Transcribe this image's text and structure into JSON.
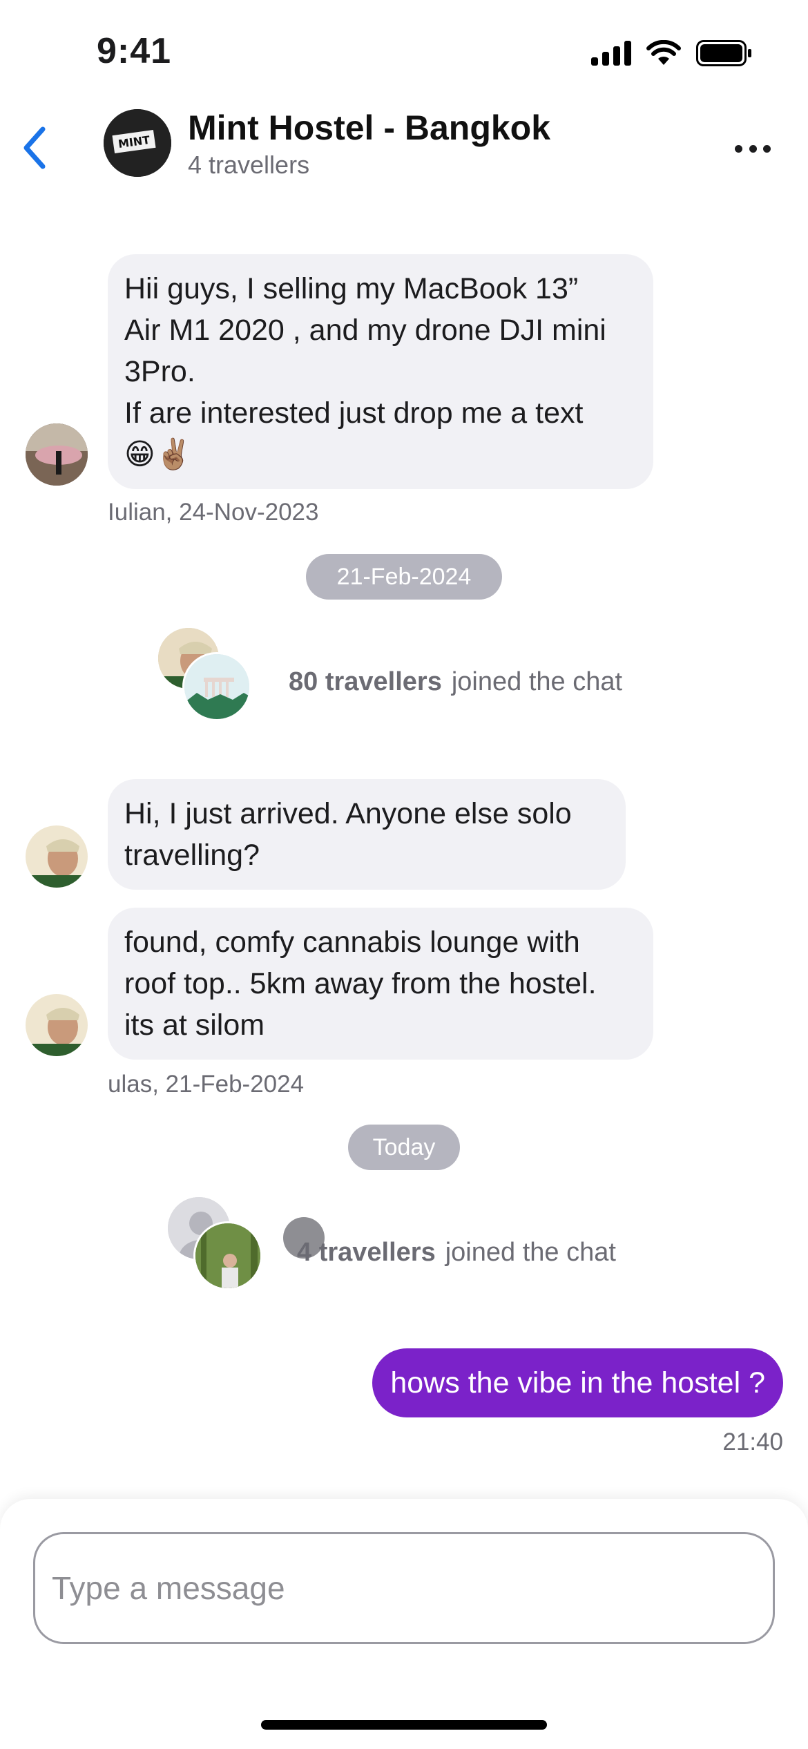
{
  "status_bar": {
    "time": "9:41"
  },
  "header": {
    "title": "Mint Hostel - Bangkok",
    "subtitle": "4 travellers",
    "avatar_text": "MINT"
  },
  "messages": [
    {
      "text": "Hii  guys, I selling my MacBook 13”\nAir M1 2020 , and my drone DJI mini\n3Pro.\nIf are interested just drop me a text\n😁✌🏽",
      "meta": "Iulian, 24-Nov-2023"
    },
    {
      "text": "Hi, I just arrived. Anyone else solo\ntravelling?"
    },
    {
      "text": "found, comfy cannabis lounge with\nroof top.. 5km away from the hostel.\nits at silom",
      "meta": "ulas, 21-Feb-2024"
    }
  ],
  "date_separators": [
    "21-Feb-2024",
    "Today"
  ],
  "join_events": [
    {
      "count": "80 travellers",
      "suffix": "joined the chat"
    },
    {
      "count": "4 travellers",
      "suffix": "joined the chat"
    }
  ],
  "sent_message": {
    "text": "hows the vibe in the hostel ?",
    "time": "21:40"
  },
  "composer": {
    "placeholder": "Type a message"
  },
  "colors": {
    "accent": "#1a73e8",
    "sent_bubble": "#7b22c9",
    "received_bubble": "#f1f1f5",
    "pill": "#b5b5bf"
  }
}
